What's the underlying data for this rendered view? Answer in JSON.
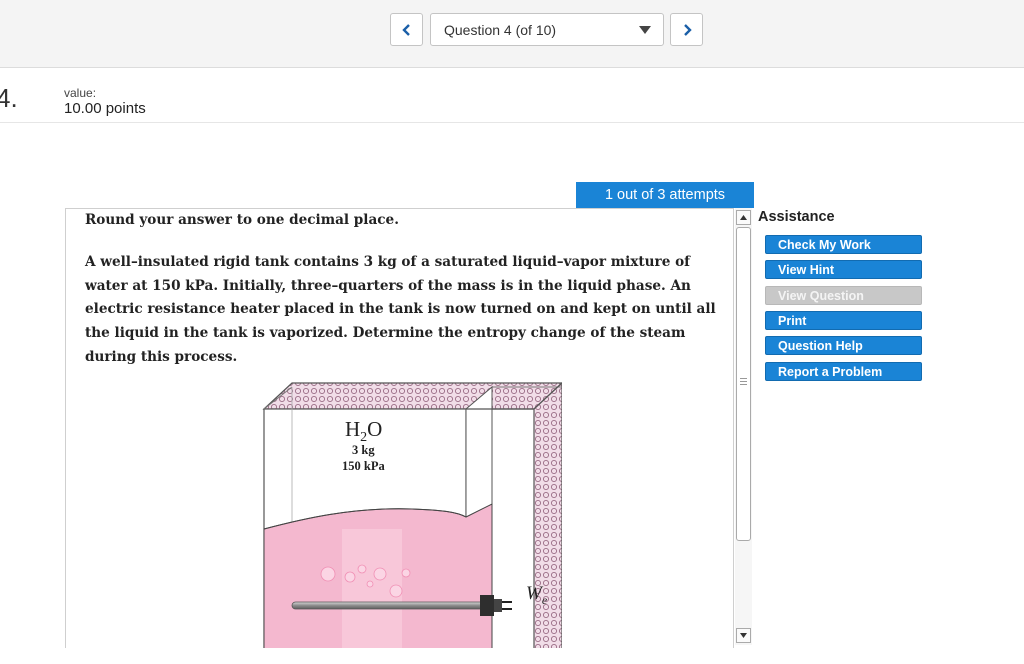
{
  "nav": {
    "question_label": "Question 4 (of 10)"
  },
  "question": {
    "number": "4.",
    "value_label": "value:",
    "value_points": "10.00 points",
    "attempts": "1 out of 3 attempts",
    "instruction": "Round your answer to one decimal place.",
    "problem_text": "A well–insulated rigid tank contains 3 kg of a saturated liquid–vapor mixture of water at 150 kPa. Initially, three–quarters of the mass is in the liquid phase. An electric resistance heater placed in the tank is now turned on and kept on until all the liquid in the tank is vaporized. Determine the entropy change of the steam during this process."
  },
  "figure": {
    "substance_main": "H",
    "substance_sub": "2",
    "substance_end": "O",
    "mass": "3 kg",
    "pressure": "150 kPa",
    "work_main": "W",
    "work_sub": "e",
    "colors": {
      "liquid": "#f4b8cf",
      "vapor": "#ffffff",
      "insulation": "#d9b0c6"
    }
  },
  "assistance": {
    "title": "Assistance",
    "buttons": [
      {
        "label": "Check My Work",
        "enabled": true
      },
      {
        "label": "View Hint",
        "enabled": true
      },
      {
        "label": "View Question",
        "enabled": false
      },
      {
        "label": "Print",
        "enabled": true
      },
      {
        "label": "Question Help",
        "enabled": true
      },
      {
        "label": "Report a Problem",
        "enabled": true
      }
    ]
  },
  "icons": {
    "prev": "chevron-left-icon",
    "next": "chevron-right-icon",
    "dropdown": "caret-down-icon",
    "scroll_up": "arrow-up-icon",
    "scroll_down": "arrow-down-icon"
  },
  "theme": {
    "accent": "#1a84d6",
    "disabled": "#c8c8c8"
  }
}
